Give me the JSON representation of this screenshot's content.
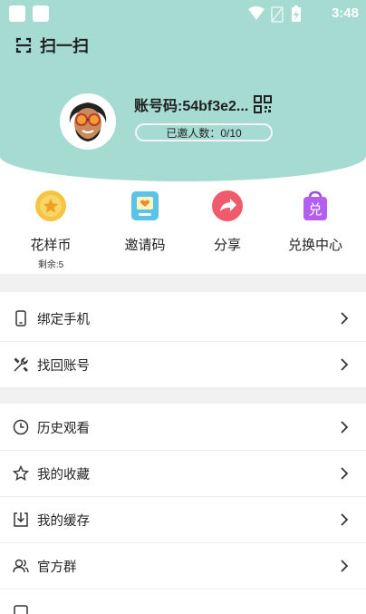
{
  "status_bar": {
    "time": "3:48"
  },
  "header": {
    "scan_label": "扫一扫",
    "account_code": "账号码:54bf3e2...",
    "invite_count": "已邀人数：0/10",
    "bg_color": "#a6dbd1"
  },
  "actions": [
    {
      "label": "花样币",
      "sub": "剩余:5",
      "icon": "coin-icon"
    },
    {
      "label": "邀请码",
      "icon": "invite-card-icon"
    },
    {
      "label": "分享",
      "icon": "share-icon"
    },
    {
      "label": "兑换中心",
      "icon": "exchange-bag-icon"
    }
  ],
  "menu_section_1": [
    {
      "label": "绑定手机",
      "icon": "phone-icon"
    },
    {
      "label": "找回账号",
      "icon": "tools-icon"
    }
  ],
  "menu_section_2": [
    {
      "label": "历史观看",
      "icon": "clock-icon"
    },
    {
      "label": "我的收藏",
      "icon": "star-icon"
    },
    {
      "label": "我的缓存",
      "icon": "download-icon"
    },
    {
      "label": "官方群",
      "icon": "group-icon"
    }
  ]
}
